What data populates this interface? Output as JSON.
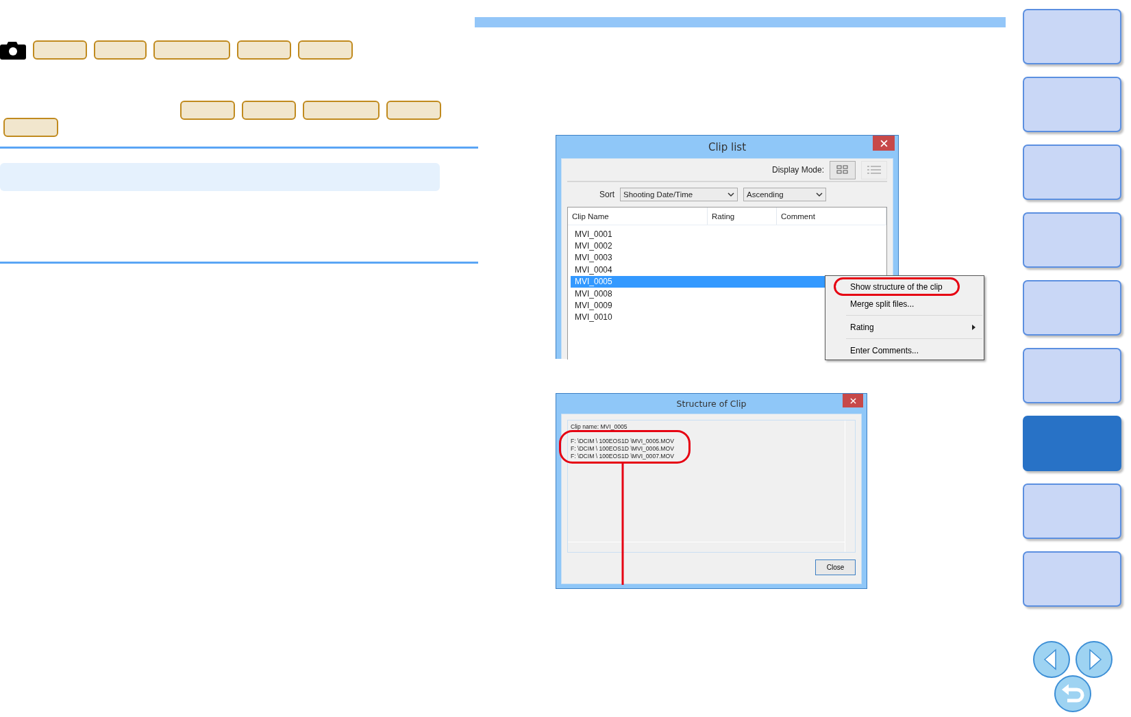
{
  "sidebar": {
    "tabs": [
      {
        "selected": false
      },
      {
        "selected": false
      },
      {
        "selected": false
      },
      {
        "selected": false
      },
      {
        "selected": false
      },
      {
        "selected": false
      },
      {
        "selected": true
      },
      {
        "selected": false
      },
      {
        "selected": false
      }
    ]
  },
  "clip_list": {
    "title": "Clip list",
    "display_mode_label": "Display Mode:",
    "view_buttons": [
      {
        "kind": "grid",
        "selected": true
      },
      {
        "kind": "list",
        "selected": false
      }
    ],
    "sort_label": "Sort",
    "sort_by": "Shooting Date/Time",
    "order": "Ascending",
    "columns": [
      "Clip Name",
      "Rating",
      "Comment"
    ],
    "rows": [
      {
        "name": "MVI_0001",
        "selected": false
      },
      {
        "name": "MVI_0002",
        "selected": false
      },
      {
        "name": "MVI_0003",
        "selected": false
      },
      {
        "name": "MVI_0004",
        "selected": false
      },
      {
        "name": "MVI_0005",
        "selected": true
      },
      {
        "name": "MVI_0008",
        "selected": false
      },
      {
        "name": "MVI_0009",
        "selected": false
      },
      {
        "name": "MVI_0010",
        "selected": false
      }
    ],
    "context_menu": [
      {
        "kind": "item",
        "label": "Show structure of the clip",
        "circled": true
      },
      {
        "kind": "item",
        "label": "Merge split files...",
        "circled": false
      },
      {
        "kind": "separator"
      },
      {
        "kind": "submenu",
        "label": "Rating",
        "circled": false
      },
      {
        "kind": "separator"
      },
      {
        "kind": "item",
        "label": "Enter Comments...",
        "circled": false
      }
    ]
  },
  "structure_of_clip": {
    "title": "Structure of Clip",
    "clip_name": "Clip name: MVI_0005",
    "paths": [
      "F: \\DCIM \\ 100EOS1D \\MVI_0005.MOV",
      "F: \\DCIM \\ 100EOS1D \\MVI_0006.MOV",
      "F: \\DCIM \\ 100EOS1D \\MVI_0007.MOV"
    ],
    "paths_circled": true,
    "close_button": "Close"
  }
}
